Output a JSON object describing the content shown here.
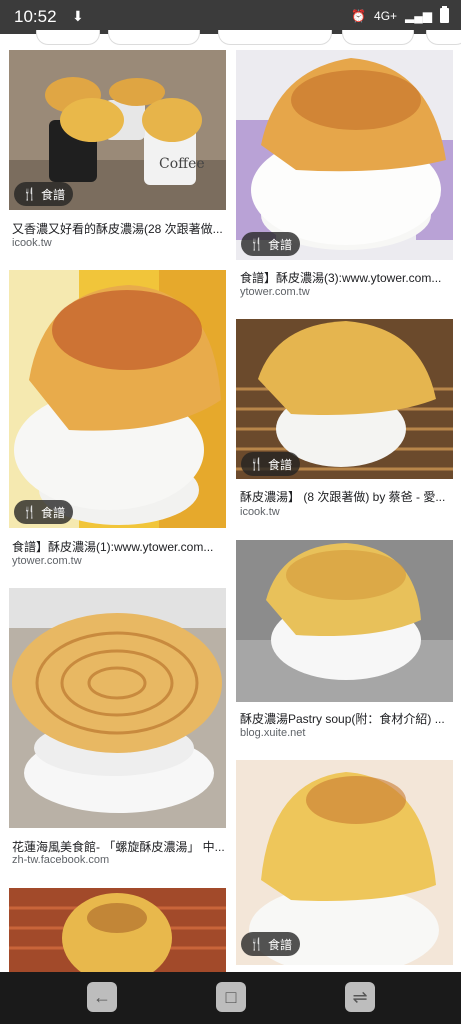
{
  "status_bar": {
    "time": "10:52",
    "network": "4G+",
    "left_icon": "download-icon",
    "right_icons": [
      "alarm-icon",
      "signal-icon",
      "battery-icon"
    ]
  },
  "results": [
    {
      "title": "又香濃又好看的酥皮濃湯(28 次跟著做...",
      "domain": "icook.tw",
      "badge": "食譜"
    },
    {
      "title": "食譜】酥皮濃湯(3):www.ytower.com...",
      "domain": "ytower.com.tw",
      "badge": "食譜"
    },
    {
      "title": "食譜】酥皮濃湯(1):www.ytower.com...",
      "domain": "ytower.com.tw",
      "badge": "食譜"
    },
    {
      "title": "酥皮濃湯】 (8 次跟著做) by 蔡爸 - 愛...",
      "domain": "icook.tw",
      "badge": "食譜"
    },
    {
      "title": "花蓮海風美食館- 「螺旋酥皮濃湯」 中...",
      "domain": "zh-tw.facebook.com",
      "badge": ""
    },
    {
      "title": "酥皮濃湯Pastry soup(附：食材介紹) ...",
      "domain": "blog.xuite.net",
      "badge": ""
    },
    {
      "title": "",
      "domain": "",
      "badge": ""
    },
    {
      "title": "",
      "domain": "",
      "badge": "食譜"
    }
  ],
  "nav_bar": {
    "buttons": [
      "back-icon",
      "home-icon",
      "recents-icon"
    ],
    "back_glyph": "←",
    "home_glyph": "□",
    "recents_glyph": "⇌"
  },
  "colors": {
    "status_bar": "#3b3b3b",
    "nav_bar": "#1a1a1a",
    "pastry": "#e9b84a",
    "pastry_dark": "#c9752a",
    "bowl": "#f4f4f2",
    "badge_bg": "#232323"
  }
}
